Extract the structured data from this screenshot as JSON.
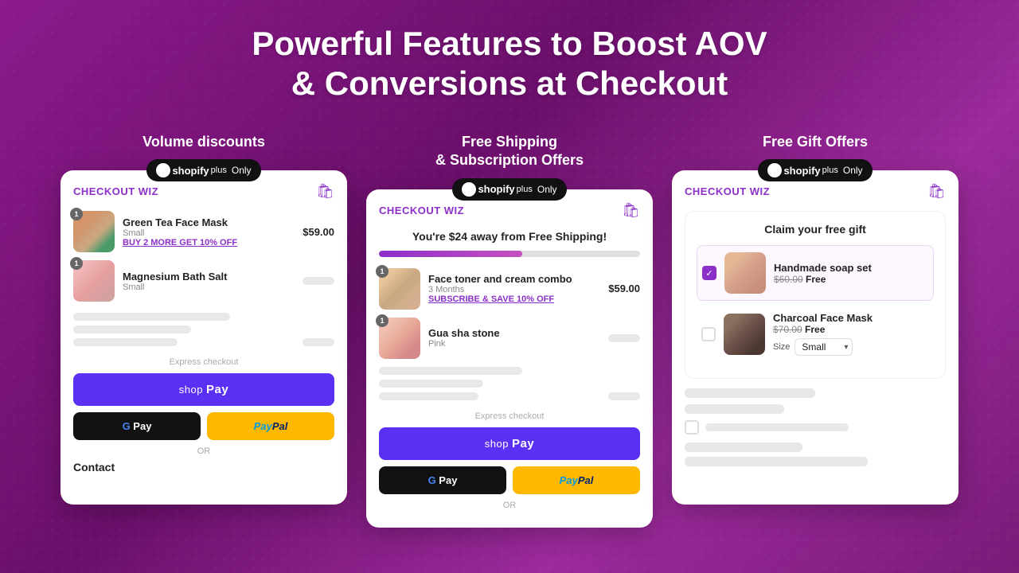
{
  "hero": {
    "title_line1": "Powerful Features to Boost AOV",
    "title_line2": "& Conversions at Checkout"
  },
  "features": [
    {
      "id": "volume-discounts",
      "label": "Volume discounts",
      "badge": "shopifyplus Only",
      "card": {
        "brand": "CHECKOUT WIZ",
        "products": [
          {
            "name": "Green Tea Face Mask",
            "variant": "Small",
            "price": "$59.00",
            "badge": "1",
            "link": "BUY 2 MORE GET 10% OFF"
          },
          {
            "name": "Magnesium Bath Salt",
            "variant": "Small",
            "badge": "1"
          }
        ],
        "express_checkout": "Express checkout",
        "or": "OR",
        "contact": "Contact"
      }
    },
    {
      "id": "free-shipping",
      "label": "Free Shipping\n& Subscription Offers",
      "badge": "shopifyplus Only",
      "card": {
        "brand": "CHECKOUT WIZ",
        "shipping_banner": "You're $24 away from Free Shipping!",
        "progress": 55,
        "products": [
          {
            "name": "Face toner and cream combo",
            "variant": "3 Months",
            "price": "$59.00",
            "badge": "1",
            "link": "SUBSCRIBE & SAVE 10% OFF"
          },
          {
            "name": "Gua sha stone",
            "variant": "Pink",
            "badge": "1"
          }
        ],
        "express_checkout": "Express checkout",
        "or": "OR"
      }
    },
    {
      "id": "free-gift",
      "label": "Free Gift Offers",
      "badge": "shopifyplus Only",
      "card": {
        "brand": "CHECKOUT WIZ",
        "free_gift": {
          "title": "Claim your free gift",
          "items": [
            {
              "name": "Handmade soap set",
              "original_price": "$60.00",
              "free_text": "Free",
              "selected": true
            },
            {
              "name": "Charcoal Face Mask",
              "original_price": "$70.00",
              "free_text": "Free",
              "selected": false,
              "size_label": "Size",
              "size_value": "Small"
            }
          ]
        }
      }
    }
  ],
  "icons": {
    "cart": "🛍",
    "check": "✓",
    "shopify_bag": "🛍"
  }
}
